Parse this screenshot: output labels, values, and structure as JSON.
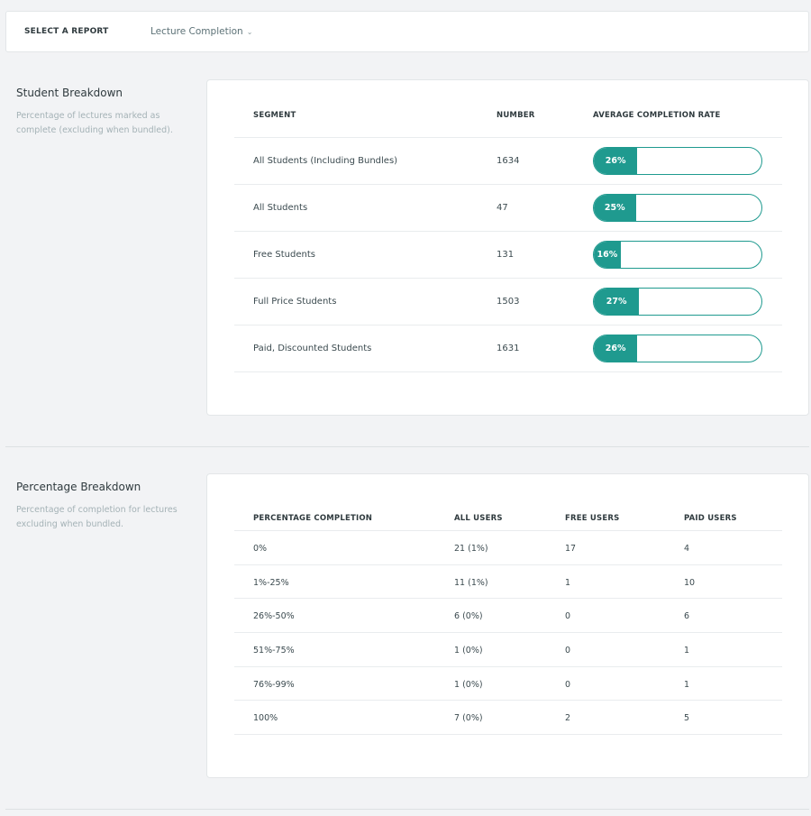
{
  "report_selector": {
    "label": "SELECT A REPORT",
    "selected": "Lecture Completion",
    "chevron_icon": "chevron-down-icon"
  },
  "student_breakdown": {
    "title": "Student Breakdown",
    "description": "Percentage of lectures marked as complete (excluding when bundled).",
    "columns": [
      "SEGMENT",
      "NUMBER",
      "AVERAGE COMPLETION RATE"
    ],
    "accent_color": "#1f9a8f",
    "rows": [
      {
        "segment": "All Students (Including Bundles)",
        "number": "1634",
        "rate_label": "26%",
        "rate": 26
      },
      {
        "segment": "All Students",
        "number": "47",
        "rate_label": "25%",
        "rate": 25
      },
      {
        "segment": "Free Students",
        "number": "131",
        "rate_label": "16%",
        "rate": 16
      },
      {
        "segment": "Full Price Students",
        "number": "1503",
        "rate_label": "27%",
        "rate": 27
      },
      {
        "segment": "Paid, Discounted Students",
        "number": "1631",
        "rate_label": "26%",
        "rate": 26
      }
    ]
  },
  "percentage_breakdown": {
    "title": "Percentage Breakdown",
    "description": "Percentage of completion for lectures excluding when bundled.",
    "columns": [
      "PERCENTAGE COMPLETION",
      "ALL USERS",
      "FREE USERS",
      "PAID USERS"
    ],
    "rows": [
      {
        "range": "0%",
        "all": "21 (1%)",
        "free": "17",
        "paid": "4"
      },
      {
        "range": "1%-25%",
        "all": "11 (1%)",
        "free": "1",
        "paid": "10"
      },
      {
        "range": "26%-50%",
        "all": "6 (0%)",
        "free": "0",
        "paid": "6"
      },
      {
        "range": "51%-75%",
        "all": "1 (0%)",
        "free": "0",
        "paid": "1"
      },
      {
        "range": "76%-99%",
        "all": "1 (0%)",
        "free": "0",
        "paid": "1"
      },
      {
        "range": "100%",
        "all": "7 (0%)",
        "free": "2",
        "paid": "5"
      }
    ]
  }
}
